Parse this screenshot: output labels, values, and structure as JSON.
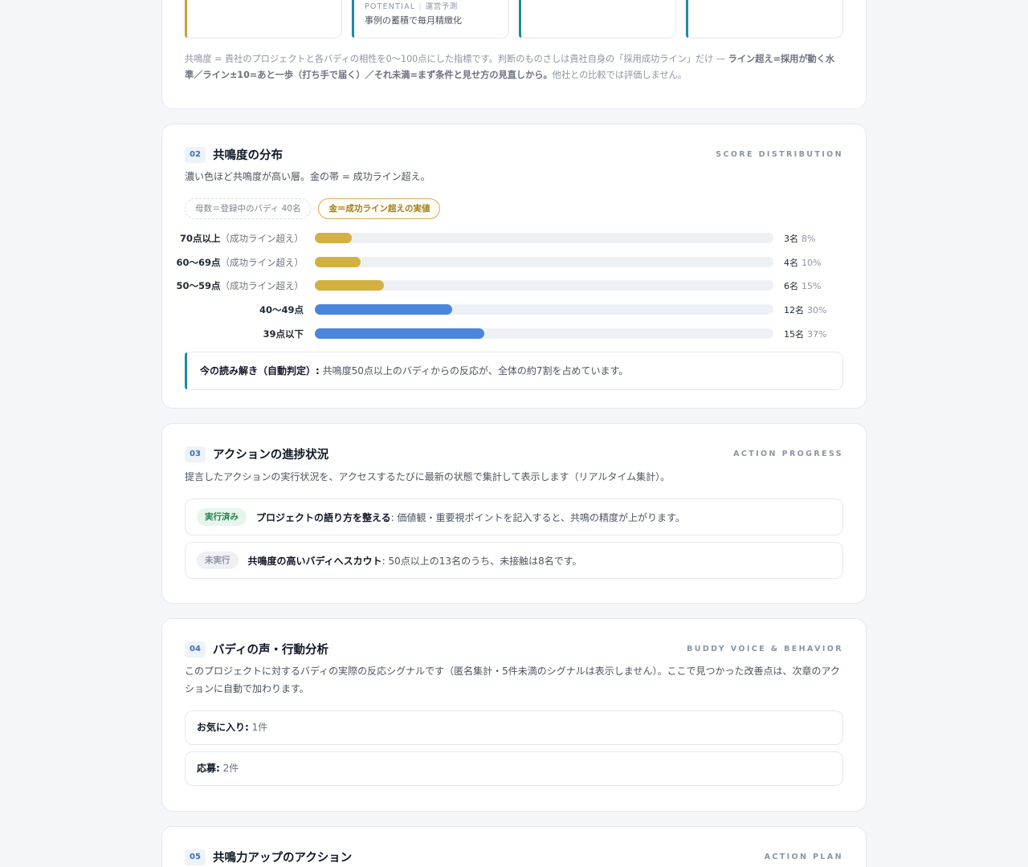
{
  "top": {
    "mini_tag_en": "POTENTIAL",
    "mini_tag_ja": "運営予測",
    "mini_text": "事例の蓄積で毎月精緻化",
    "note_prefix": "共鳴度 = 貴社のプロジェクトと各バディの相性を0〜100点にした指標です。判断のものさしは貴社自身の「採用成功ライン」だけ — ",
    "note_bold1": "ライン超え=採用が動く水準／ライン±10=あと一歩（打ち手で届く）／それ未満=まず条件と見せ方の見直しから。",
    "note_suffix": "他社との比較では評価しません。"
  },
  "distribution": {
    "num": "02",
    "title": "共鳴度の分布",
    "en": "SCORE DISTRIBUTION",
    "desc": "濃い色ほど共鳴度が高い層。金の帯 = 成功ライン超え。",
    "chip_base": "母数＝登録中のバディ 40名",
    "chip_gold": "金＝成功ライン超えの実値",
    "callout_label": "今の読み解き（自動判定）:",
    "callout_text": " 共鳴度50点以上のバディからの反応が、全体の約7割を占めています。"
  },
  "chart_data": {
    "type": "bar",
    "categories": [
      "70点以上",
      "60〜69点",
      "50〜59点",
      "40〜49点",
      "39点以下"
    ],
    "notes": [
      "（成功ライン超え）",
      "（成功ライン超え）",
      "（成功ライン超え）",
      "",
      ""
    ],
    "counts": [
      "3名",
      "4名",
      "6名",
      "12名",
      "15名"
    ],
    "percents": [
      "8%",
      "10%",
      "15%",
      "30%",
      "37%"
    ],
    "values": [
      8,
      10,
      15,
      30,
      37
    ],
    "above_line": [
      true,
      true,
      true,
      false,
      false
    ],
    "max": 100,
    "colors": {
      "above": "#d4b040",
      "below": "#4a86de",
      "track": "#edf1f6"
    }
  },
  "actions": {
    "num": "03",
    "title": "アクションの進捗状況",
    "en": "ACTION PROGRESS",
    "desc": "提言したアクションの実行状況を、アクセスするたびに最新の状態で集計して表示します（リアルタイム集計）。",
    "items": [
      {
        "status": "実行済み",
        "title": "プロジェクトの語り方を整える",
        "text": ": 価値観・重要視ポイントを記入すると、共鳴の精度が上がります。"
      },
      {
        "status": "未実行",
        "title": "共鳴度の高いバディへスカウト",
        "text": ": 50点以上の13名のうち、未接触は8名です。"
      }
    ]
  },
  "voice": {
    "num": "04",
    "title": "バディの声・行動分析",
    "en": "BUDDY VOICE & BEHAVIOR",
    "desc": "このプロジェクトに対するバディの実際の反応シグナルです（匿名集計・5件未満のシグナルは表示しません）。ここで見つかった改善点は、次章のアクションに自動で加わります。",
    "stats": [
      {
        "label": "お気に入り:",
        "value": " 1件"
      },
      {
        "label": "応募:",
        "value": " 2件"
      }
    ]
  },
  "plan": {
    "num": "05",
    "title": "共鳴力アップのアクション",
    "en": "ACTION PLAN"
  }
}
